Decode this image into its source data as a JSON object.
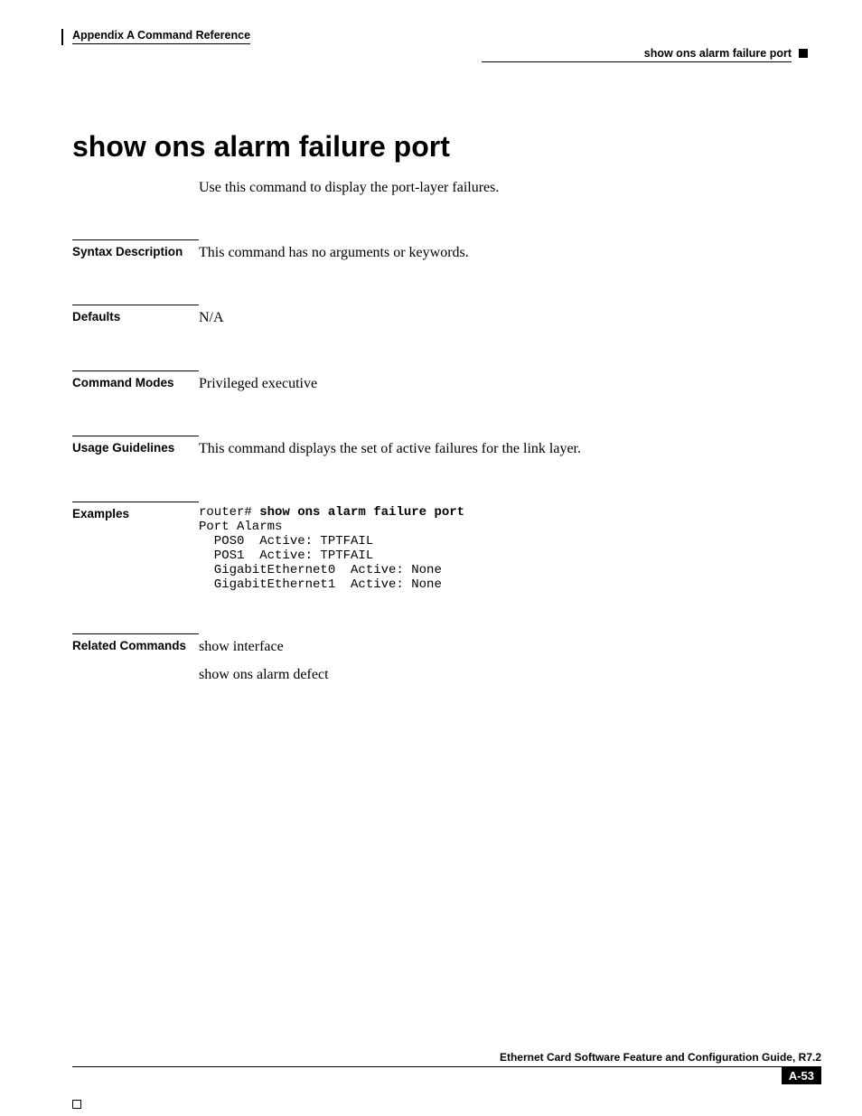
{
  "header": {
    "appendix": "Appendix A Command Reference",
    "topic": "show ons alarm failure port"
  },
  "title": "show ons alarm failure port",
  "intro": "Use this command to display the port-layer failures.",
  "sections": {
    "syntax": {
      "label": "Syntax Description",
      "body": "This command has no arguments or keywords."
    },
    "defaults": {
      "label": "Defaults",
      "body": "N/A"
    },
    "modes": {
      "label": "Command Modes",
      "body": "Privileged executive"
    },
    "usage": {
      "label": "Usage Guidelines",
      "body": "This command displays the set of active failures for the link layer."
    },
    "examples": {
      "label": "Examples",
      "prompt": "router# ",
      "command": "show ons alarm failure port",
      "output": "Port Alarms\n  POS0  Active: TPTFAIL\n  POS1  Active: TPTFAIL\n  GigabitEthernet0  Active: None\n  GigabitEthernet1  Active: None"
    },
    "related": {
      "label": "Related Commands",
      "items": [
        "show interface",
        "show ons alarm defect"
      ]
    }
  },
  "footer": {
    "guide": "Ethernet Card Software Feature and Configuration Guide, R7.2",
    "page": "A-53"
  }
}
